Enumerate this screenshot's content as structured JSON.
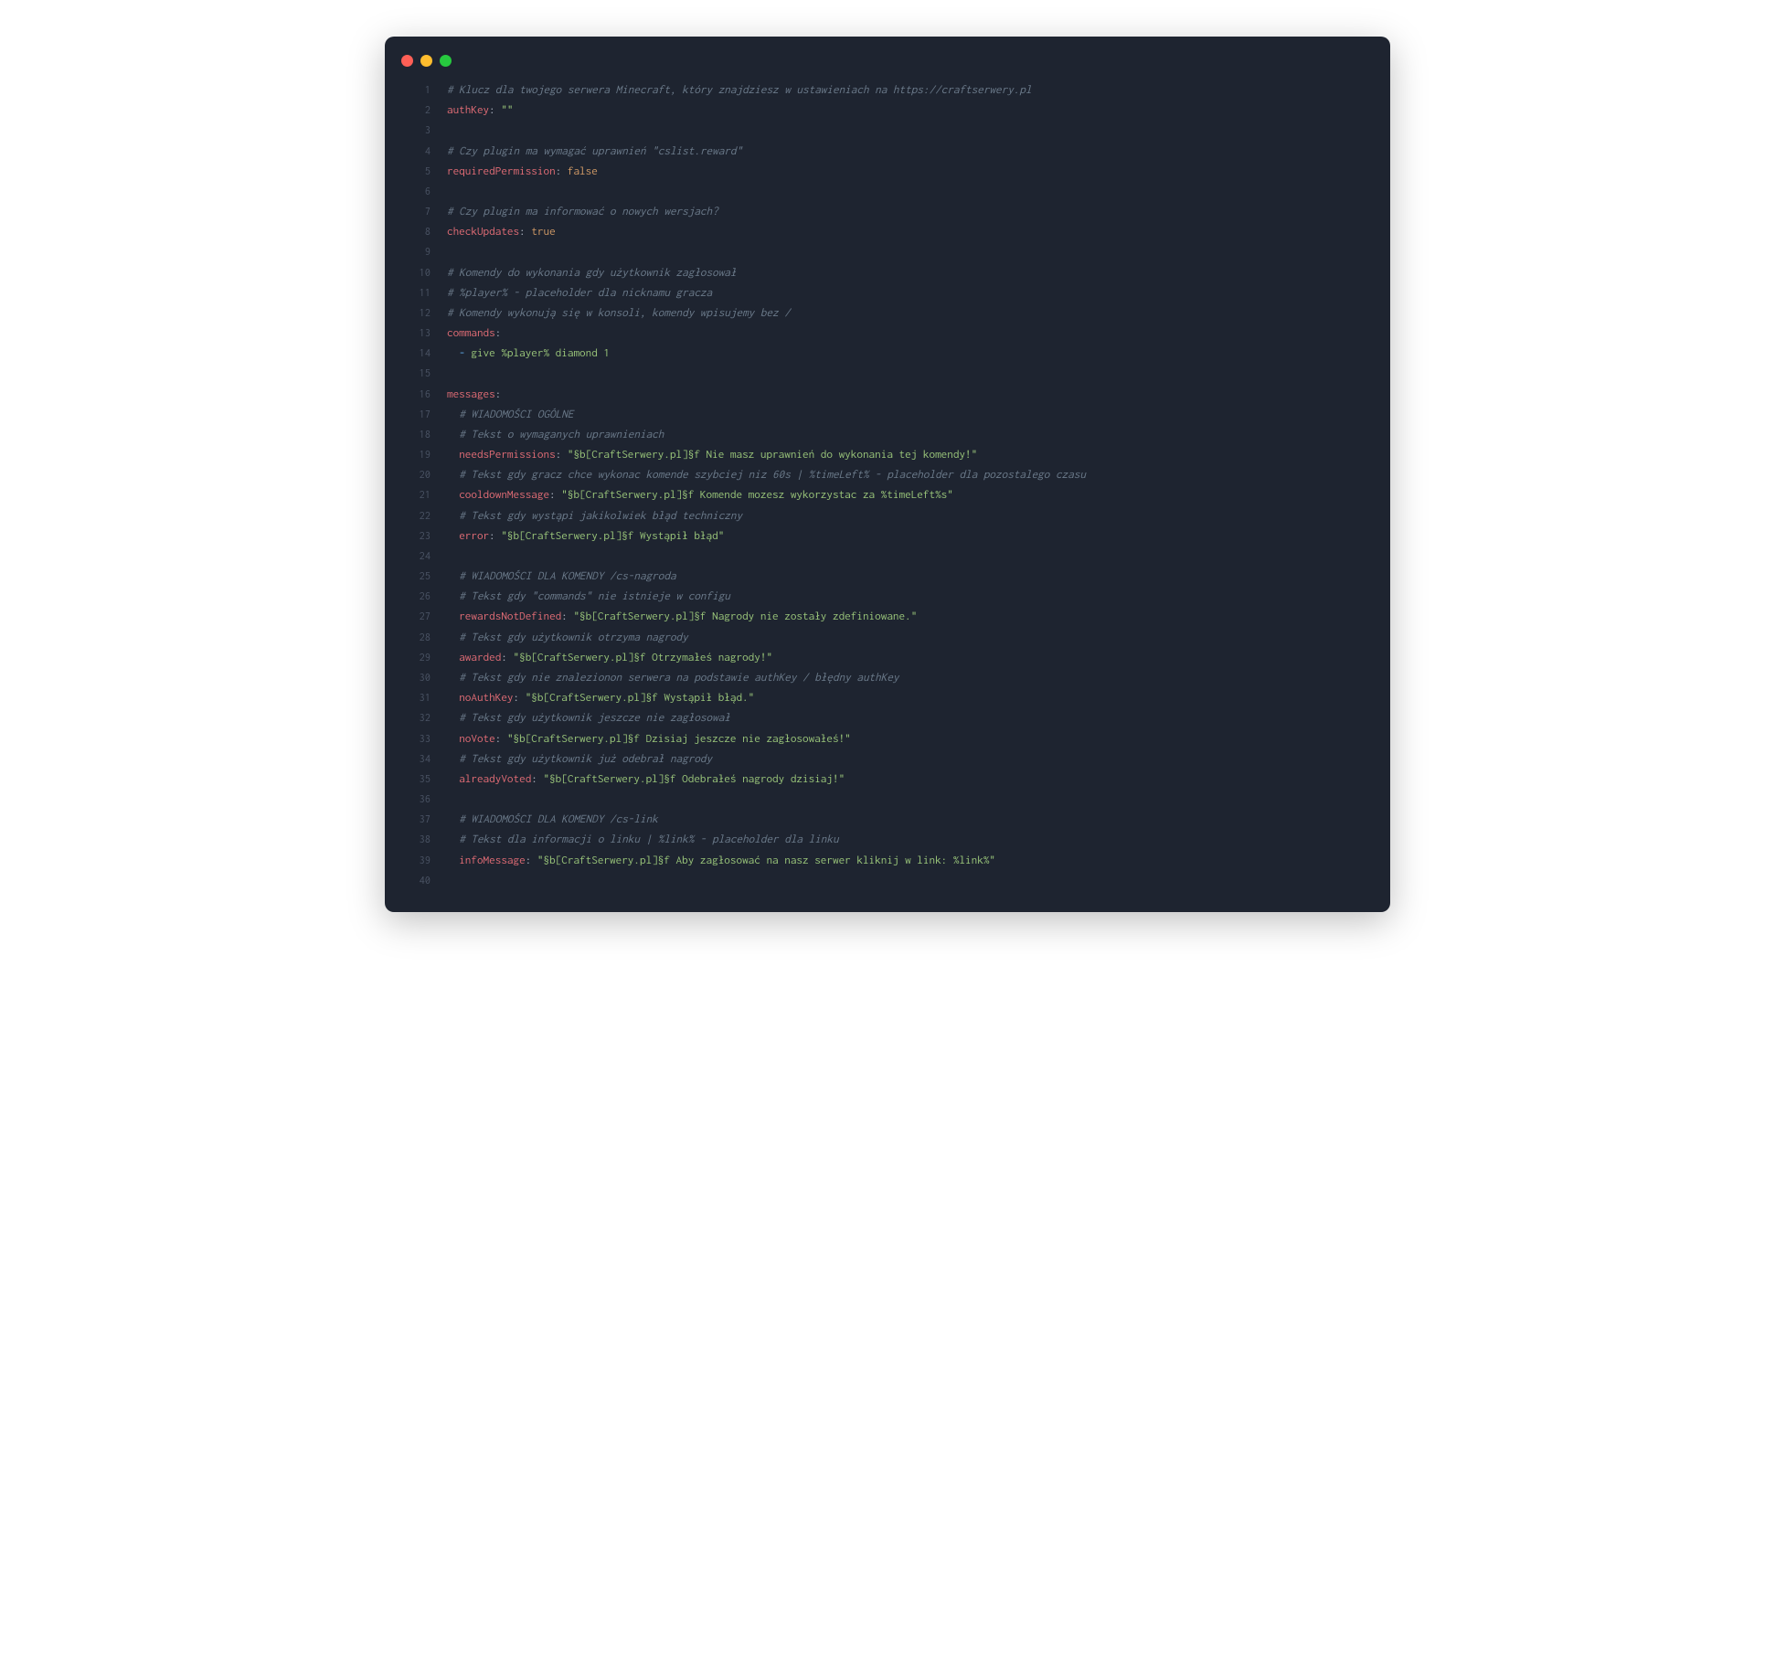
{
  "window": {
    "buttons": [
      "close",
      "minimize",
      "maximize"
    ]
  },
  "colors": {
    "bg": "#1e2430",
    "gutter": "#4a5364",
    "comment": "#6b7a8a",
    "key": "#e06c75",
    "string": "#98c379",
    "bool": "#d19a66",
    "punc": "#abb2bf",
    "seq": "#61afef"
  },
  "code": {
    "language": "yaml",
    "lines": [
      {
        "n": 1,
        "t": [
          [
            "comment",
            "# Klucz dla twojego serwera Minecraft, który znajdziesz w ustawieniach na https://craftserwery.pl"
          ]
        ]
      },
      {
        "n": 2,
        "t": [
          [
            "key",
            "authKey"
          ],
          [
            "punc",
            ":"
          ],
          [
            "plain",
            " "
          ],
          [
            "string",
            "\"\""
          ]
        ]
      },
      {
        "n": 3,
        "t": []
      },
      {
        "n": 4,
        "t": [
          [
            "comment",
            "# Czy plugin ma wymagać uprawnień \"cslist.reward\""
          ]
        ]
      },
      {
        "n": 5,
        "t": [
          [
            "key",
            "requiredPermission"
          ],
          [
            "punc",
            ":"
          ],
          [
            "plain",
            " "
          ],
          [
            "bool",
            "false"
          ]
        ]
      },
      {
        "n": 6,
        "t": []
      },
      {
        "n": 7,
        "t": [
          [
            "comment",
            "# Czy plugin ma informować o nowych wersjach?"
          ]
        ]
      },
      {
        "n": 8,
        "t": [
          [
            "key",
            "checkUpdates"
          ],
          [
            "punc",
            ":"
          ],
          [
            "plain",
            " "
          ],
          [
            "bool",
            "true"
          ]
        ]
      },
      {
        "n": 9,
        "t": []
      },
      {
        "n": 10,
        "t": [
          [
            "comment",
            "# Komendy do wykonania gdy użytkownik zagłosował"
          ]
        ]
      },
      {
        "n": 11,
        "t": [
          [
            "comment",
            "# %player% - placeholder dla nicknamu gracza"
          ]
        ]
      },
      {
        "n": 12,
        "t": [
          [
            "comment",
            "# Komendy wykonują się w konsoli, komendy wpisujemy bez /"
          ]
        ]
      },
      {
        "n": 13,
        "t": [
          [
            "key",
            "commands"
          ],
          [
            "punc",
            ":"
          ]
        ]
      },
      {
        "n": 14,
        "t": [
          [
            "plain",
            "  "
          ],
          [
            "seq",
            "-"
          ],
          [
            "plain",
            " "
          ],
          [
            "string",
            "give %player% diamond 1"
          ]
        ]
      },
      {
        "n": 15,
        "t": []
      },
      {
        "n": 16,
        "t": [
          [
            "key",
            "messages"
          ],
          [
            "punc",
            ":"
          ]
        ]
      },
      {
        "n": 17,
        "t": [
          [
            "plain",
            "  "
          ],
          [
            "comment",
            "# WIADOMOŚCI OGÓLNE"
          ]
        ]
      },
      {
        "n": 18,
        "t": [
          [
            "plain",
            "  "
          ],
          [
            "comment",
            "# Tekst o wymaganych uprawnieniach"
          ]
        ]
      },
      {
        "n": 19,
        "t": [
          [
            "plain",
            "  "
          ],
          [
            "key",
            "needsPermissions"
          ],
          [
            "punc",
            ":"
          ],
          [
            "plain",
            " "
          ],
          [
            "string",
            "\"§b[CraftSerwery.pl]§f Nie masz uprawnień do wykonania tej komendy!\""
          ]
        ]
      },
      {
        "n": 20,
        "t": [
          [
            "plain",
            "  "
          ],
          [
            "comment",
            "# Tekst gdy gracz chce wykonac komende szybciej niz 60s | %timeLeft% - placeholder dla pozostalego czasu"
          ]
        ]
      },
      {
        "n": 21,
        "t": [
          [
            "plain",
            "  "
          ],
          [
            "key",
            "cooldownMessage"
          ],
          [
            "punc",
            ":"
          ],
          [
            "plain",
            " "
          ],
          [
            "string",
            "\"§b[CraftSerwery.pl]§f Komende mozesz wykorzystac za %timeLeft%s\""
          ]
        ]
      },
      {
        "n": 22,
        "t": [
          [
            "plain",
            "  "
          ],
          [
            "comment",
            "# Tekst gdy wystąpi jakikolwiek błąd techniczny"
          ]
        ]
      },
      {
        "n": 23,
        "t": [
          [
            "plain",
            "  "
          ],
          [
            "key",
            "error"
          ],
          [
            "punc",
            ":"
          ],
          [
            "plain",
            " "
          ],
          [
            "string",
            "\"§b[CraftSerwery.pl]§f Wystąpił błąd\""
          ]
        ]
      },
      {
        "n": 24,
        "t": []
      },
      {
        "n": 25,
        "t": [
          [
            "plain",
            "  "
          ],
          [
            "comment",
            "# WIADOMOŚCI DLA KOMENDY /cs-nagroda"
          ]
        ]
      },
      {
        "n": 26,
        "t": [
          [
            "plain",
            "  "
          ],
          [
            "comment",
            "# Tekst gdy \"commands\" nie istnieje w configu"
          ]
        ]
      },
      {
        "n": 27,
        "t": [
          [
            "plain",
            "  "
          ],
          [
            "key",
            "rewardsNotDefined"
          ],
          [
            "punc",
            ":"
          ],
          [
            "plain",
            " "
          ],
          [
            "string",
            "\"§b[CraftSerwery.pl]§f Nagrody nie zostały zdefiniowane.\""
          ]
        ]
      },
      {
        "n": 28,
        "t": [
          [
            "plain",
            "  "
          ],
          [
            "comment",
            "# Tekst gdy użytkownik otrzyma nagrody"
          ]
        ]
      },
      {
        "n": 29,
        "t": [
          [
            "plain",
            "  "
          ],
          [
            "key",
            "awarded"
          ],
          [
            "punc",
            ":"
          ],
          [
            "plain",
            " "
          ],
          [
            "string",
            "\"§b[CraftSerwery.pl]§f Otrzymałeś nagrody!\""
          ]
        ]
      },
      {
        "n": 30,
        "t": [
          [
            "plain",
            "  "
          ],
          [
            "comment",
            "# Tekst gdy nie znalezionon serwera na podstawie authKey / błędny authKey"
          ]
        ]
      },
      {
        "n": 31,
        "t": [
          [
            "plain",
            "  "
          ],
          [
            "key",
            "noAuthKey"
          ],
          [
            "punc",
            ":"
          ],
          [
            "plain",
            " "
          ],
          [
            "string",
            "\"§b[CraftSerwery.pl]§f Wystąpił błąd.\""
          ]
        ]
      },
      {
        "n": 32,
        "t": [
          [
            "plain",
            "  "
          ],
          [
            "comment",
            "# Tekst gdy użytkownik jeszcze nie zagłosował"
          ]
        ]
      },
      {
        "n": 33,
        "t": [
          [
            "plain",
            "  "
          ],
          [
            "key",
            "noVote"
          ],
          [
            "punc",
            ":"
          ],
          [
            "plain",
            " "
          ],
          [
            "string",
            "\"§b[CraftSerwery.pl]§f Dzisiaj jeszcze nie zagłosowałeś!\""
          ]
        ]
      },
      {
        "n": 34,
        "t": [
          [
            "plain",
            "  "
          ],
          [
            "comment",
            "# Tekst gdy użytkownik już odebrał nagrody"
          ]
        ]
      },
      {
        "n": 35,
        "t": [
          [
            "plain",
            "  "
          ],
          [
            "key",
            "alreadyVoted"
          ],
          [
            "punc",
            ":"
          ],
          [
            "plain",
            " "
          ],
          [
            "string",
            "\"§b[CraftSerwery.pl]§f Odebrałeś nagrody dzisiaj!\""
          ]
        ]
      },
      {
        "n": 36,
        "t": []
      },
      {
        "n": 37,
        "t": [
          [
            "plain",
            "  "
          ],
          [
            "comment",
            "# WIADOMOŚCI DLA KOMENDY /cs-link"
          ]
        ]
      },
      {
        "n": 38,
        "t": [
          [
            "plain",
            "  "
          ],
          [
            "comment",
            "# Tekst dla informacji o linku | %link% - placeholder dla linku"
          ]
        ]
      },
      {
        "n": 39,
        "t": [
          [
            "plain",
            "  "
          ],
          [
            "key",
            "infoMessage"
          ],
          [
            "punc",
            ":"
          ],
          [
            "plain",
            " "
          ],
          [
            "string",
            "\"§b[CraftSerwery.pl]§f Aby zagłosować na nasz serwer kliknij w link: %link%\""
          ]
        ]
      },
      {
        "n": 40,
        "t": []
      }
    ]
  }
}
